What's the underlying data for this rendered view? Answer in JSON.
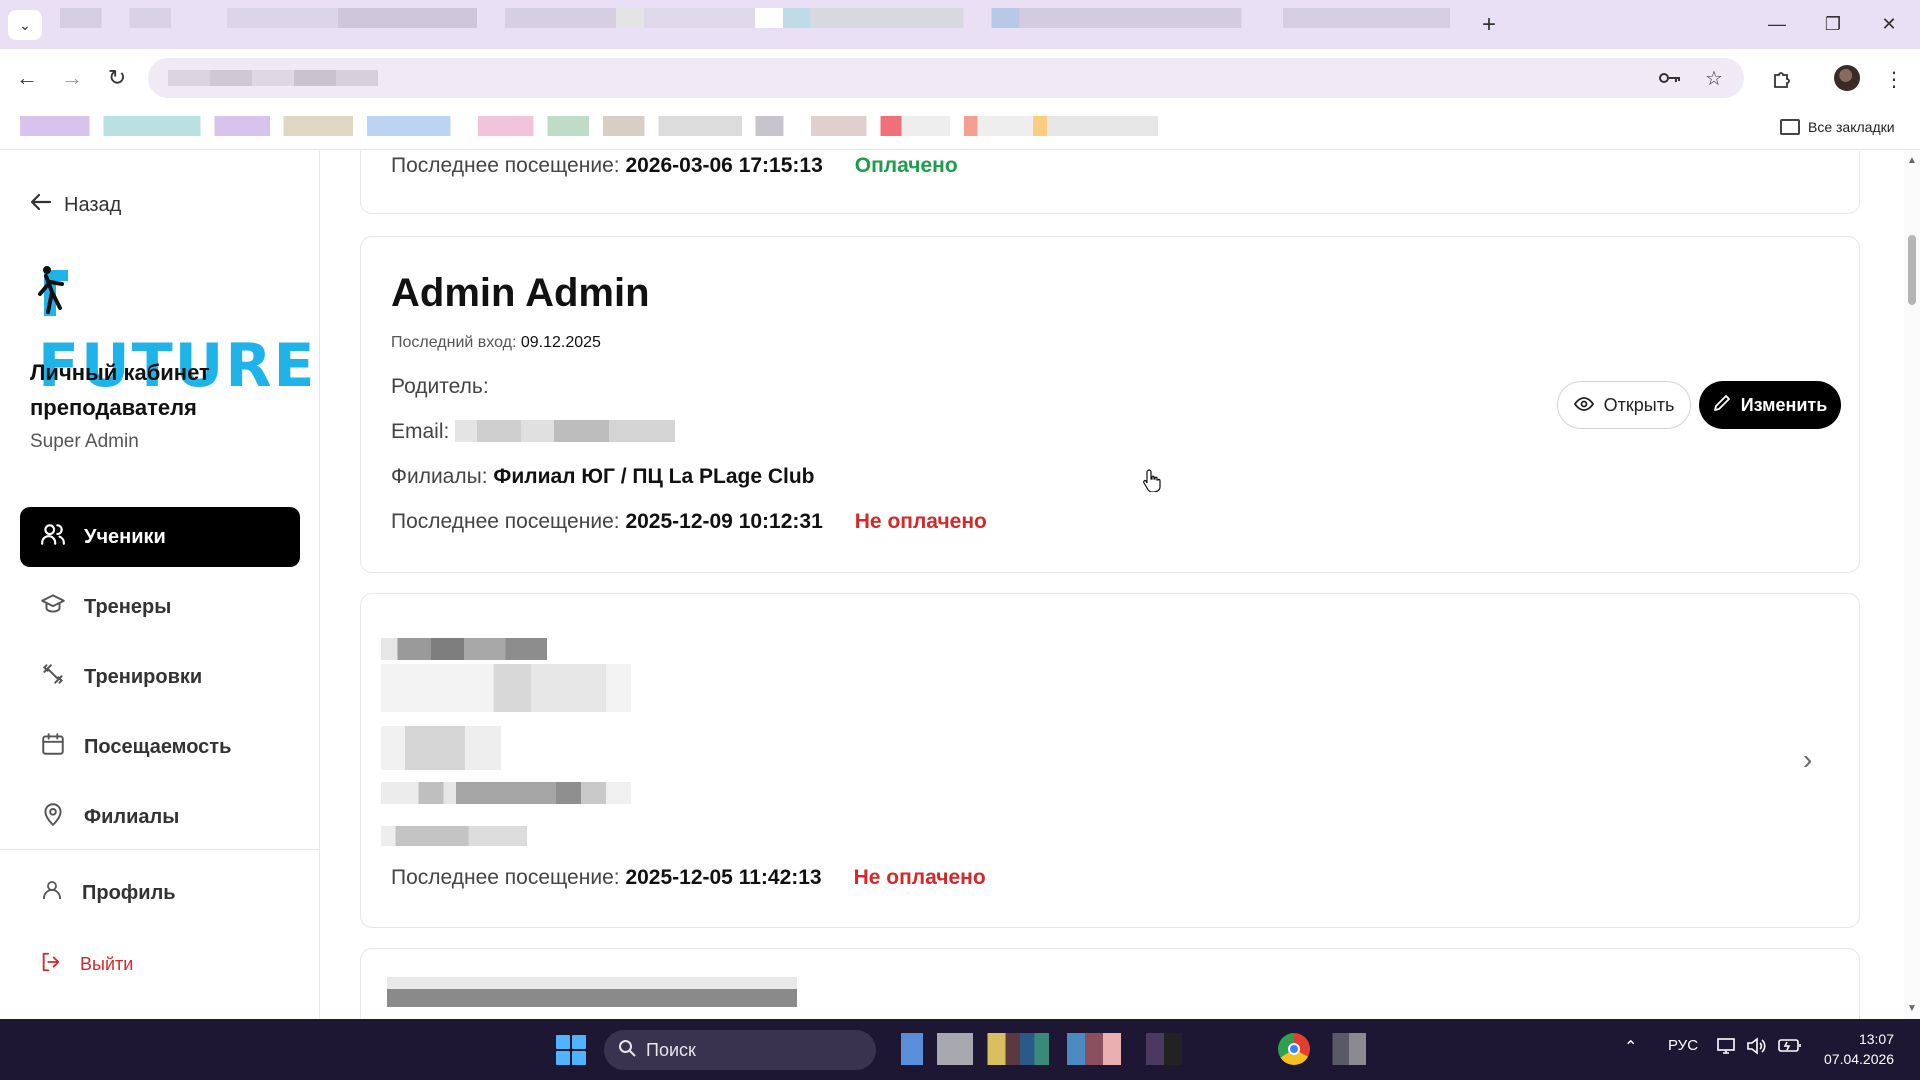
{
  "browser": {
    "bookmarks_all_label": "Все закладки"
  },
  "sidebar": {
    "back_label": "Назад",
    "logo_text": "FUTURE",
    "cabinet_title": "Личный кабинет преподавателя",
    "role": "Super Admin",
    "nav": [
      {
        "label": "Ученики",
        "active": true,
        "icon": "users-icon"
      },
      {
        "label": "Тренеры",
        "icon": "graduation-cap-icon"
      },
      {
        "label": "Тренировки",
        "icon": "dumbbell-icon"
      },
      {
        "label": "Посещаемость",
        "icon": "calendar-icon"
      },
      {
        "label": "Филиалы",
        "icon": "map-pin-icon"
      }
    ],
    "profile_label": "Профиль",
    "logout_label": "Выйти"
  },
  "students": {
    "card0": {
      "last_visit_label": "Последнее посещение:",
      "last_visit": "2026-03-06 17:15:13",
      "status": "Оплачено"
    },
    "card1": {
      "name": "Admin Admin",
      "last_login_label": "Последний вход:",
      "last_login": "09.12.2025",
      "parent_label": "Родитель:",
      "email_label": "Email:",
      "branches_label": "Филиалы:",
      "branches": "Филиал ЮГ / ПЦ La PLage Club",
      "last_visit_label": "Последнее посещение:",
      "last_visit": "2025-12-09 10:12:31",
      "status": "Не оплачено",
      "open_label": "Открыть",
      "edit_label": "Изменить"
    },
    "card2": {
      "last_visit_label": "Последнее посещение:",
      "last_visit": "2025-12-05 11:42:13",
      "status": "Не оплачено"
    }
  },
  "taskbar": {
    "search_placeholder": "Поиск",
    "language": "РУС",
    "time": "13:07",
    "date": "07.04.2026"
  },
  "colors": {
    "accent": "#1fb3ea",
    "paid": "#1f9d4b",
    "unpaid": "#d62828",
    "active_nav": "#000000"
  }
}
